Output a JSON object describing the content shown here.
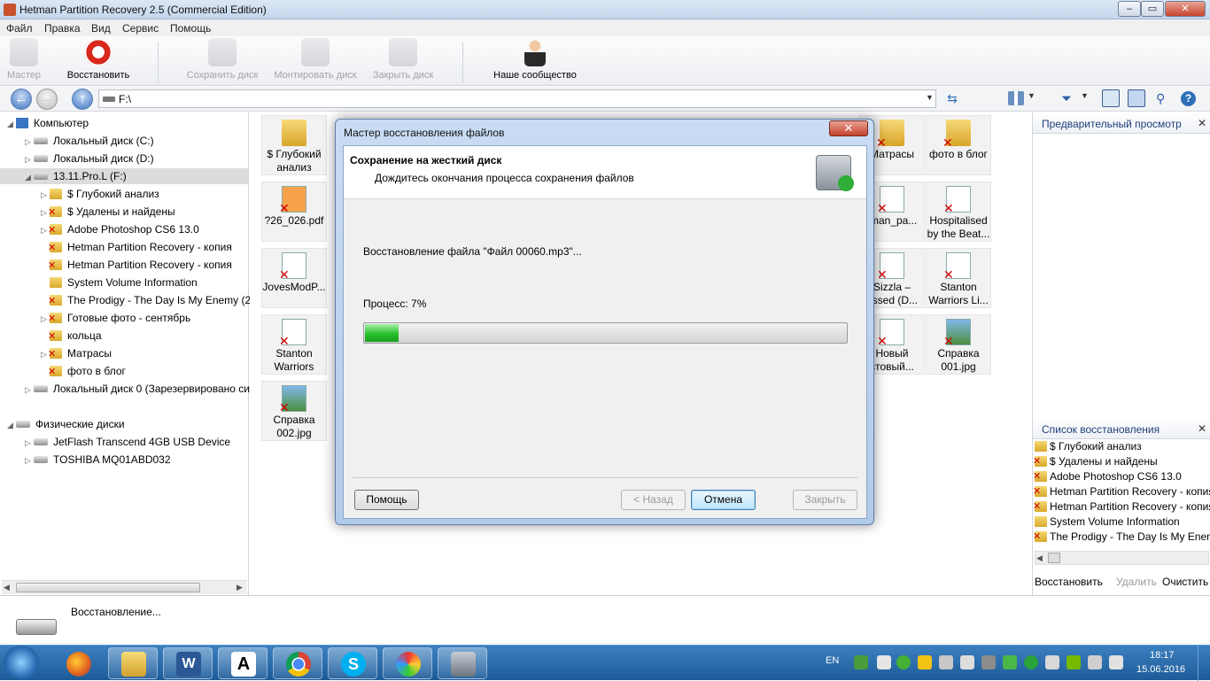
{
  "window": {
    "title": "Hetman Partition Recovery 2.5 (Commercial Edition)"
  },
  "menu": [
    "Файл",
    "Правка",
    "Вид",
    "Сервис",
    "Помощь"
  ],
  "toolbar": {
    "wizard": "Мастер",
    "restore": "Восстановить",
    "save_disk": "Сохранить диск",
    "mount_disk": "Монтировать диск",
    "close_disk": "Закрыть диск",
    "community": "Наше сообщество"
  },
  "address": {
    "path": "F:\\"
  },
  "tree": {
    "computer": "Компьютер",
    "items": [
      "Локальный диск (C:)",
      "Локальный диск (D:)",
      "13.11.Pro.L (F:)",
      "$ Глубокий анализ",
      "$ Удалены и найдены",
      "Adobe Photoshop CS6 13.0",
      "Hetman Partition Recovery - копия",
      "Hetman Partition Recovery - копия",
      "System Volume Information",
      "The Prodigy - The Day Is My Enemy (2",
      "Готовые фото - сентябрь",
      "кольца",
      "Матрасы",
      "фото в блог",
      "Локальный диск 0 (Зарезервировано си"
    ],
    "physical": "Физические диски",
    "physical_items": [
      "JetFlash Transcend 4GB USB Device",
      "TOSHIBA MQ01ABD032"
    ]
  },
  "files": {
    "left": [
      "$ Глубокий анализ",
      "?26_026.pdf",
      "JovesModP...",
      "Stanton Warriors Po...",
      "Справка 002.jpg"
    ],
    "right1": [
      "Матрасы",
      "tman_pa...",
      "Sizzla – essed (D...",
      "Новый стовый..."
    ],
    "right2": [
      "фото в блог",
      "Hospitalised by the Beat...",
      "Stanton Warriors Li...",
      "Справка 001.jpg"
    ]
  },
  "preview": {
    "title": "Предварительный просмотр"
  },
  "recovery_list": {
    "title": "Список восстановления",
    "items": [
      "$ Глубокий анализ",
      "$ Удалены и найдены",
      "Adobe Photoshop CS6 13.0",
      "Hetman Partition Recovery - копия",
      "Hetman Partition Recovery - копия",
      "System Volume Information",
      "The Prodigy - The Day Is My Enemy"
    ],
    "restore": "Восстановить",
    "delete": "Удалить",
    "clear": "Очистить с"
  },
  "status": {
    "text": "Восстановление..."
  },
  "dialog": {
    "title": "Мастер восстановления файлов",
    "heading": "Сохранение на жесткий диск",
    "subheading": "Дождитесь окончания процесса сохранения файлов",
    "file_text": "Восстановление файла \"Файл 00060.mp3\"...",
    "progress_label": "Процесс: 7%",
    "progress": 0.07,
    "help": "Помощь",
    "back": "< Назад",
    "cancel": "Отмена",
    "close": "Закрыть"
  },
  "taskbar": {
    "lang": "EN",
    "time": "18:17",
    "date": "15.06.2016"
  }
}
